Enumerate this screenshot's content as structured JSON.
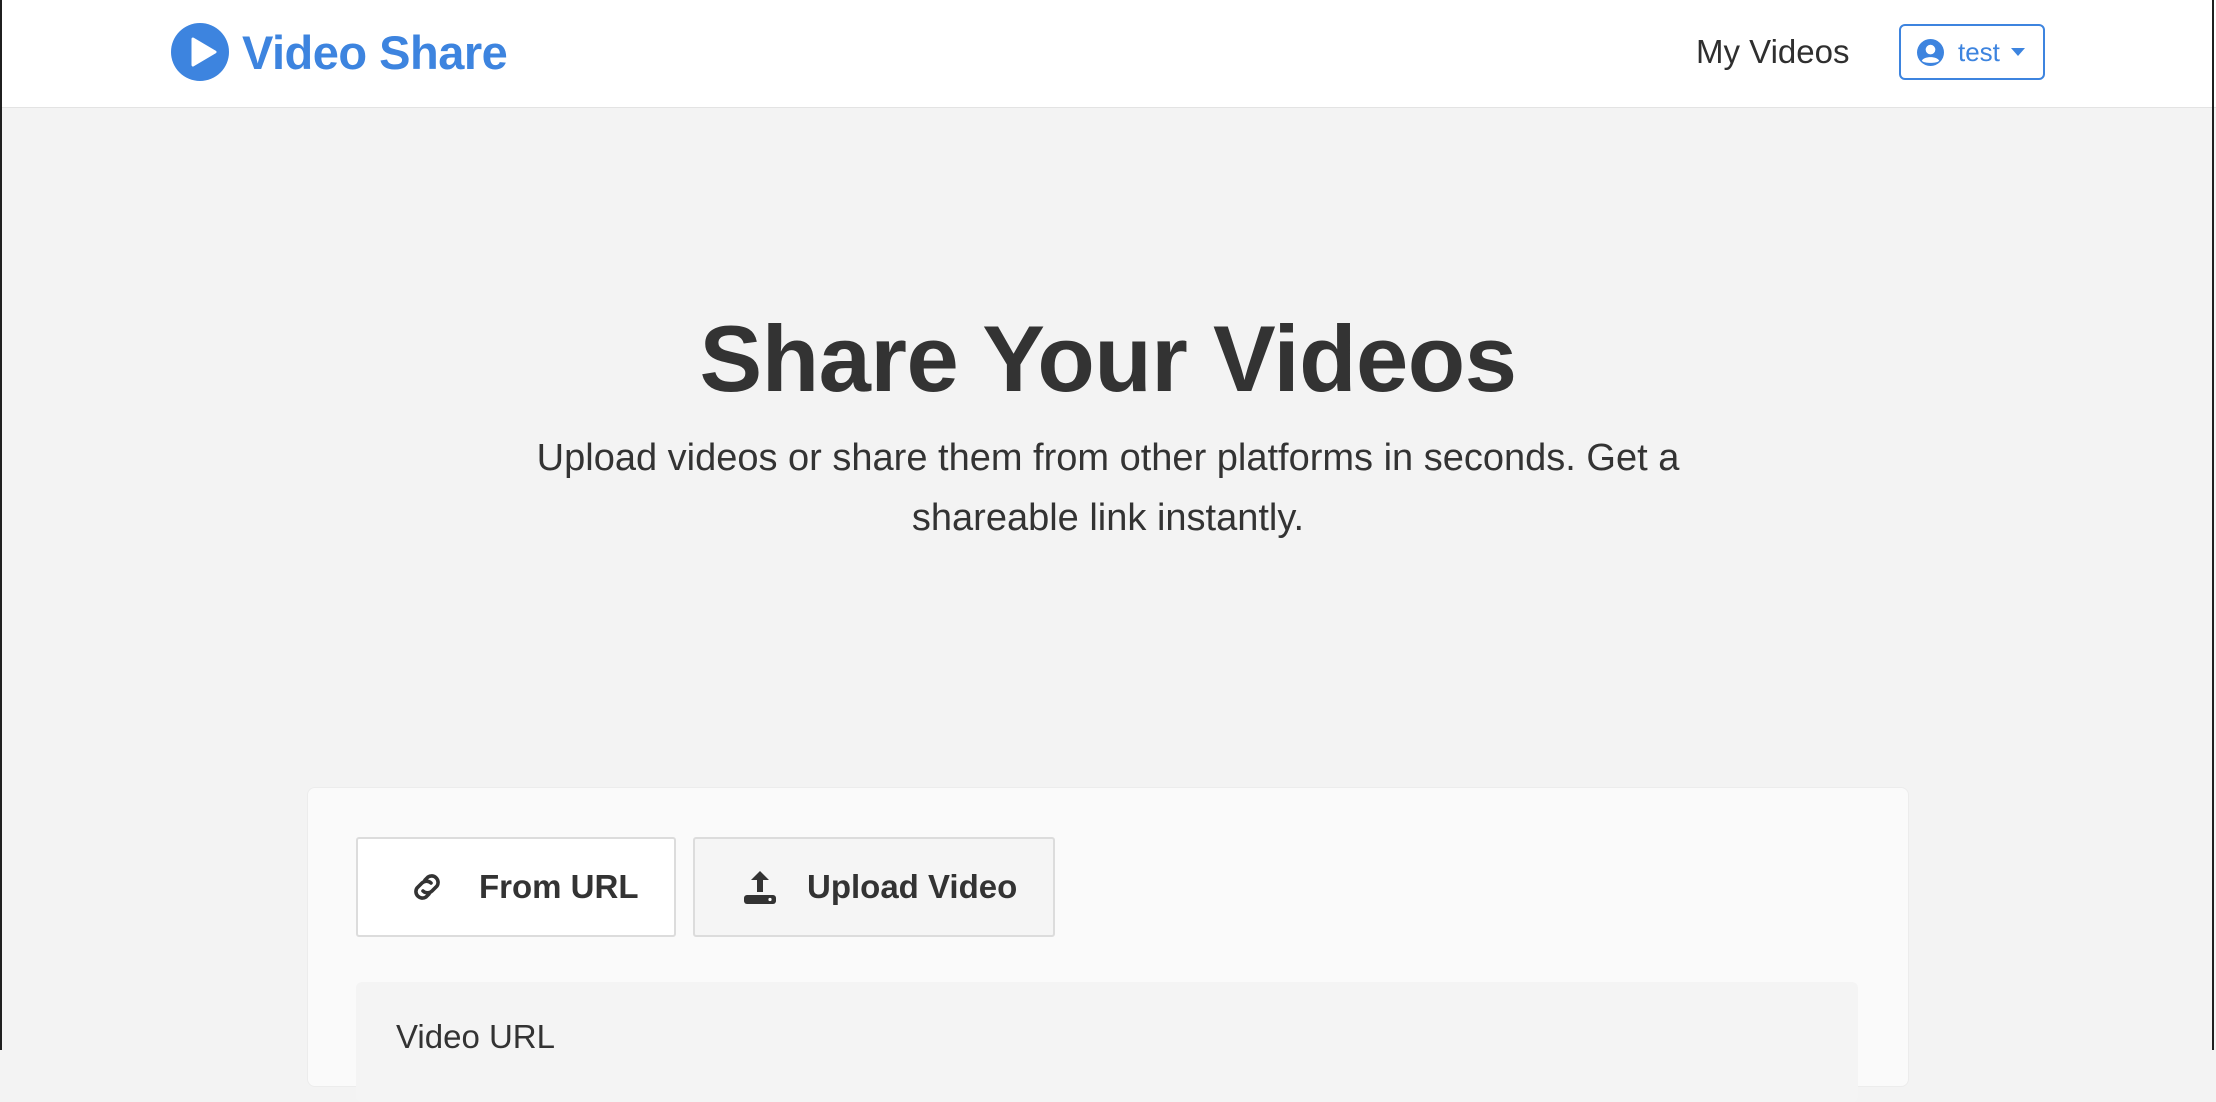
{
  "brand": {
    "name": "Video Share",
    "icon": "play-circle-icon",
    "color": "#3d84df"
  },
  "nav": {
    "my_videos": "My Videos",
    "user": {
      "name": "test",
      "icon": "user-circle-icon",
      "caret_icon": "caret-down-icon"
    }
  },
  "hero": {
    "title": "Share Your Videos",
    "subtitle": "Upload videos or share them from other platforms in seconds. Get a shareable link instantly."
  },
  "upload_card": {
    "tabs": [
      {
        "label": "From URL",
        "icon": "link-icon",
        "active": true
      },
      {
        "label": "Upload Video",
        "icon": "upload-icon",
        "active": false
      }
    ],
    "field_label": "Video URL"
  },
  "colors": {
    "accent": "#3d84df",
    "page_background": "#f3f3f3",
    "text": "#333333"
  }
}
